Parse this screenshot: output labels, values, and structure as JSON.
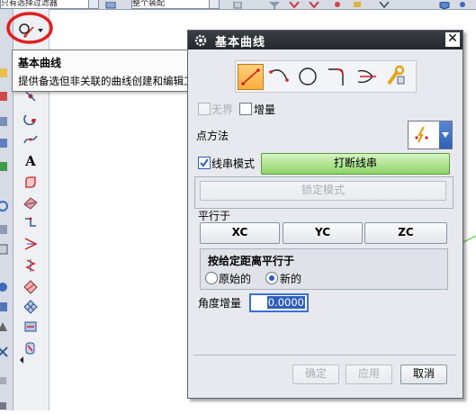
{
  "top_toolbar": {
    "filter_combo": "只有选择过滤器",
    "assembly_combo": "整个装配"
  },
  "left_toolbar": {
    "icons": [
      "basic-curve-icon",
      "point-icon",
      "line-icon",
      "spline-icon",
      "text-icon",
      "offset-curve-icon",
      "surface-curve-icon",
      "project-curve-icon",
      "bridge-curve-icon",
      "helix-icon",
      "section-curve-icon",
      "mesh-icon",
      "extract-curve-icon",
      "wrap-curve-icon"
    ],
    "text_glyph": "A"
  },
  "tooltip": {
    "title": "基本曲线",
    "description": "提供备选但非关联的曲线创建和编辑工具。"
  },
  "dialog": {
    "title": "基本曲线",
    "close_glyph": "✕",
    "curve_types": [
      "line-icon",
      "arc-icon",
      "circle-icon",
      "fillet-icon",
      "trim-icon",
      "edit-curve-params-icon"
    ],
    "unbounded_label": "无界",
    "incremental_label": "增量",
    "point_method_label": "点方法",
    "string_mode_label": "线串模式",
    "break_string_label": "打断线串",
    "lock_mode_label": "锁定模式",
    "parallel_to_label": "平行于",
    "xc_label": "XC",
    "yc_label": "YC",
    "zc_label": "ZC",
    "parallel_by_distance_label": "按给定距离平行于",
    "original_label": "原始的",
    "new_label": "新的",
    "angle_increment_label": "角度增量",
    "angle_increment_value": "0.0000",
    "ok_label": "确定",
    "apply_label": "应用",
    "cancel_label": "取消",
    "string_mode_checked": true,
    "incremental_checked": false,
    "unbounded_checked": false,
    "selected_option": "new"
  },
  "colors": {
    "highlight_circle": "#e02020",
    "title_bar": "#2b2e34",
    "green_button": "#8ed466",
    "selected_icon": "#ffb040"
  }
}
